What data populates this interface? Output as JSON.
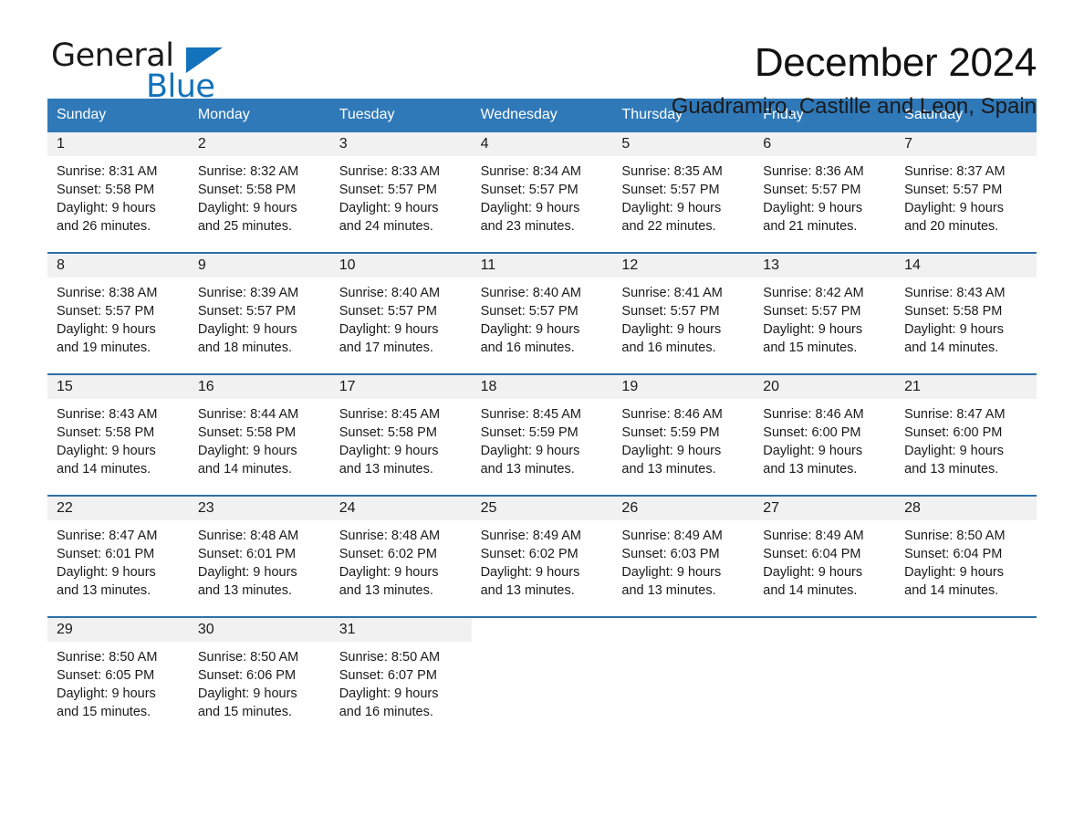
{
  "brand": {
    "word_one": "General",
    "word_two": "Blue",
    "triangle_icon": "triangle-icon",
    "blue": "#1272bb"
  },
  "header": {
    "title": "December 2024",
    "subtitle": "Guadramiro, Castille and Leon, Spain"
  },
  "theme": {
    "header_bg": "#3079b9",
    "row_border": "#2f6fa8",
    "daynum_bg": "#f1f1f1",
    "text": "#1a1a1a"
  },
  "weekdays": [
    "Sunday",
    "Monday",
    "Tuesday",
    "Wednesday",
    "Thursday",
    "Friday",
    "Saturday"
  ],
  "weeks": [
    [
      {
        "day": "1",
        "sunrise": "Sunrise: 8:31 AM",
        "sunset": "Sunset: 5:58 PM",
        "daylight_line1": "Daylight: 9 hours",
        "daylight_line2": "and 26 minutes."
      },
      {
        "day": "2",
        "sunrise": "Sunrise: 8:32 AM",
        "sunset": "Sunset: 5:58 PM",
        "daylight_line1": "Daylight: 9 hours",
        "daylight_line2": "and 25 minutes."
      },
      {
        "day": "3",
        "sunrise": "Sunrise: 8:33 AM",
        "sunset": "Sunset: 5:57 PM",
        "daylight_line1": "Daylight: 9 hours",
        "daylight_line2": "and 24 minutes."
      },
      {
        "day": "4",
        "sunrise": "Sunrise: 8:34 AM",
        "sunset": "Sunset: 5:57 PM",
        "daylight_line1": "Daylight: 9 hours",
        "daylight_line2": "and 23 minutes."
      },
      {
        "day": "5",
        "sunrise": "Sunrise: 8:35 AM",
        "sunset": "Sunset: 5:57 PM",
        "daylight_line1": "Daylight: 9 hours",
        "daylight_line2": "and 22 minutes."
      },
      {
        "day": "6",
        "sunrise": "Sunrise: 8:36 AM",
        "sunset": "Sunset: 5:57 PM",
        "daylight_line1": "Daylight: 9 hours",
        "daylight_line2": "and 21 minutes."
      },
      {
        "day": "7",
        "sunrise": "Sunrise: 8:37 AM",
        "sunset": "Sunset: 5:57 PM",
        "daylight_line1": "Daylight: 9 hours",
        "daylight_line2": "and 20 minutes."
      }
    ],
    [
      {
        "day": "8",
        "sunrise": "Sunrise: 8:38 AM",
        "sunset": "Sunset: 5:57 PM",
        "daylight_line1": "Daylight: 9 hours",
        "daylight_line2": "and 19 minutes."
      },
      {
        "day": "9",
        "sunrise": "Sunrise: 8:39 AM",
        "sunset": "Sunset: 5:57 PM",
        "daylight_line1": "Daylight: 9 hours",
        "daylight_line2": "and 18 minutes."
      },
      {
        "day": "10",
        "sunrise": "Sunrise: 8:40 AM",
        "sunset": "Sunset: 5:57 PM",
        "daylight_line1": "Daylight: 9 hours",
        "daylight_line2": "and 17 minutes."
      },
      {
        "day": "11",
        "sunrise": "Sunrise: 8:40 AM",
        "sunset": "Sunset: 5:57 PM",
        "daylight_line1": "Daylight: 9 hours",
        "daylight_line2": "and 16 minutes."
      },
      {
        "day": "12",
        "sunrise": "Sunrise: 8:41 AM",
        "sunset": "Sunset: 5:57 PM",
        "daylight_line1": "Daylight: 9 hours",
        "daylight_line2": "and 16 minutes."
      },
      {
        "day": "13",
        "sunrise": "Sunrise: 8:42 AM",
        "sunset": "Sunset: 5:57 PM",
        "daylight_line1": "Daylight: 9 hours",
        "daylight_line2": "and 15 minutes."
      },
      {
        "day": "14",
        "sunrise": "Sunrise: 8:43 AM",
        "sunset": "Sunset: 5:58 PM",
        "daylight_line1": "Daylight: 9 hours",
        "daylight_line2": "and 14 minutes."
      }
    ],
    [
      {
        "day": "15",
        "sunrise": "Sunrise: 8:43 AM",
        "sunset": "Sunset: 5:58 PM",
        "daylight_line1": "Daylight: 9 hours",
        "daylight_line2": "and 14 minutes."
      },
      {
        "day": "16",
        "sunrise": "Sunrise: 8:44 AM",
        "sunset": "Sunset: 5:58 PM",
        "daylight_line1": "Daylight: 9 hours",
        "daylight_line2": "and 14 minutes."
      },
      {
        "day": "17",
        "sunrise": "Sunrise: 8:45 AM",
        "sunset": "Sunset: 5:58 PM",
        "daylight_line1": "Daylight: 9 hours",
        "daylight_line2": "and 13 minutes."
      },
      {
        "day": "18",
        "sunrise": "Sunrise: 8:45 AM",
        "sunset": "Sunset: 5:59 PM",
        "daylight_line1": "Daylight: 9 hours",
        "daylight_line2": "and 13 minutes."
      },
      {
        "day": "19",
        "sunrise": "Sunrise: 8:46 AM",
        "sunset": "Sunset: 5:59 PM",
        "daylight_line1": "Daylight: 9 hours",
        "daylight_line2": "and 13 minutes."
      },
      {
        "day": "20",
        "sunrise": "Sunrise: 8:46 AM",
        "sunset": "Sunset: 6:00 PM",
        "daylight_line1": "Daylight: 9 hours",
        "daylight_line2": "and 13 minutes."
      },
      {
        "day": "21",
        "sunrise": "Sunrise: 8:47 AM",
        "sunset": "Sunset: 6:00 PM",
        "daylight_line1": "Daylight: 9 hours",
        "daylight_line2": "and 13 minutes."
      }
    ],
    [
      {
        "day": "22",
        "sunrise": "Sunrise: 8:47 AM",
        "sunset": "Sunset: 6:01 PM",
        "daylight_line1": "Daylight: 9 hours",
        "daylight_line2": "and 13 minutes."
      },
      {
        "day": "23",
        "sunrise": "Sunrise: 8:48 AM",
        "sunset": "Sunset: 6:01 PM",
        "daylight_line1": "Daylight: 9 hours",
        "daylight_line2": "and 13 minutes."
      },
      {
        "day": "24",
        "sunrise": "Sunrise: 8:48 AM",
        "sunset": "Sunset: 6:02 PM",
        "daylight_line1": "Daylight: 9 hours",
        "daylight_line2": "and 13 minutes."
      },
      {
        "day": "25",
        "sunrise": "Sunrise: 8:49 AM",
        "sunset": "Sunset: 6:02 PM",
        "daylight_line1": "Daylight: 9 hours",
        "daylight_line2": "and 13 minutes."
      },
      {
        "day": "26",
        "sunrise": "Sunrise: 8:49 AM",
        "sunset": "Sunset: 6:03 PM",
        "daylight_line1": "Daylight: 9 hours",
        "daylight_line2": "and 13 minutes."
      },
      {
        "day": "27",
        "sunrise": "Sunrise: 8:49 AM",
        "sunset": "Sunset: 6:04 PM",
        "daylight_line1": "Daylight: 9 hours",
        "daylight_line2": "and 14 minutes."
      },
      {
        "day": "28",
        "sunrise": "Sunrise: 8:50 AM",
        "sunset": "Sunset: 6:04 PM",
        "daylight_line1": "Daylight: 9 hours",
        "daylight_line2": "and 14 minutes."
      }
    ],
    [
      {
        "day": "29",
        "sunrise": "Sunrise: 8:50 AM",
        "sunset": "Sunset: 6:05 PM",
        "daylight_line1": "Daylight: 9 hours",
        "daylight_line2": "and 15 minutes."
      },
      {
        "day": "30",
        "sunrise": "Sunrise: 8:50 AM",
        "sunset": "Sunset: 6:06 PM",
        "daylight_line1": "Daylight: 9 hours",
        "daylight_line2": "and 15 minutes."
      },
      {
        "day": "31",
        "sunrise": "Sunrise: 8:50 AM",
        "sunset": "Sunset: 6:07 PM",
        "daylight_line1": "Daylight: 9 hours",
        "daylight_line2": "and 16 minutes."
      },
      {
        "day": "",
        "sunrise": "",
        "sunset": "",
        "daylight_line1": "",
        "daylight_line2": ""
      },
      {
        "day": "",
        "sunrise": "",
        "sunset": "",
        "daylight_line1": "",
        "daylight_line2": ""
      },
      {
        "day": "",
        "sunrise": "",
        "sunset": "",
        "daylight_line1": "",
        "daylight_line2": ""
      },
      {
        "day": "",
        "sunrise": "",
        "sunset": "",
        "daylight_line1": "",
        "daylight_line2": ""
      }
    ]
  ]
}
